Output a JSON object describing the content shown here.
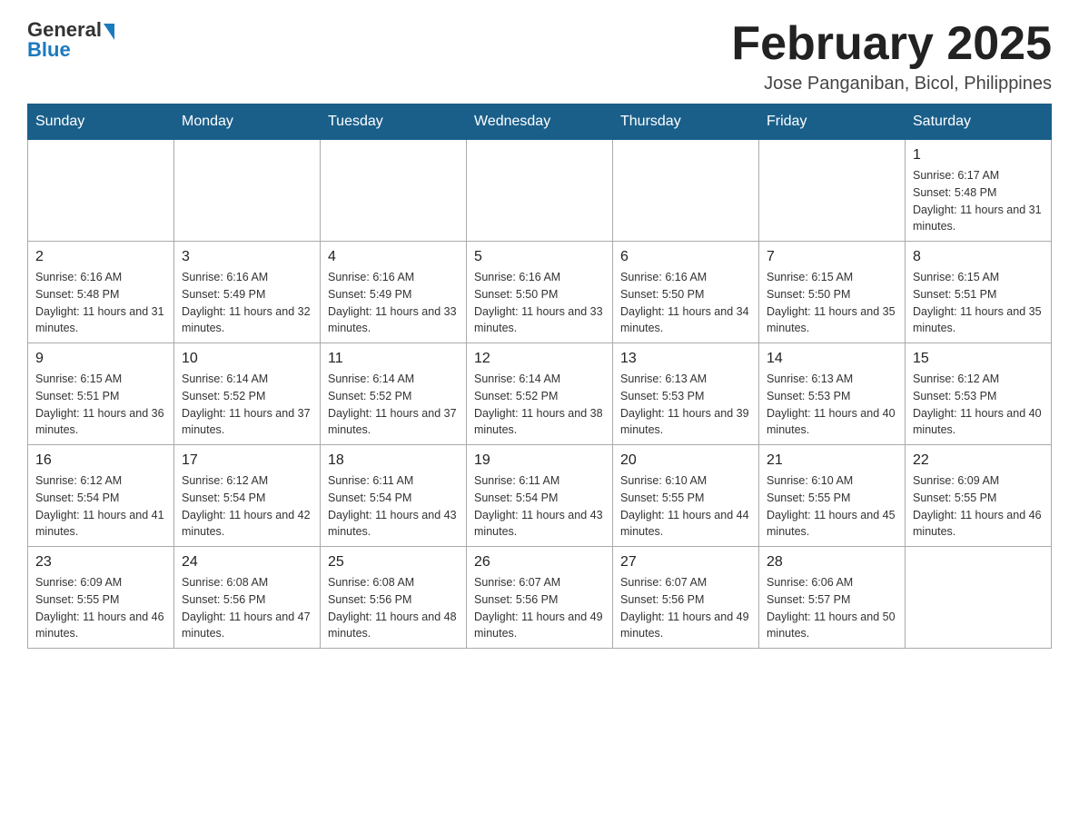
{
  "logo": {
    "general": "General",
    "blue": "Blue"
  },
  "title": "February 2025",
  "location": "Jose Panganiban, Bicol, Philippines",
  "days_of_week": [
    "Sunday",
    "Monday",
    "Tuesday",
    "Wednesday",
    "Thursday",
    "Friday",
    "Saturday"
  ],
  "weeks": [
    [
      {
        "day": "",
        "info": ""
      },
      {
        "day": "",
        "info": ""
      },
      {
        "day": "",
        "info": ""
      },
      {
        "day": "",
        "info": ""
      },
      {
        "day": "",
        "info": ""
      },
      {
        "day": "",
        "info": ""
      },
      {
        "day": "1",
        "info": "Sunrise: 6:17 AM\nSunset: 5:48 PM\nDaylight: 11 hours and 31 minutes."
      }
    ],
    [
      {
        "day": "2",
        "info": "Sunrise: 6:16 AM\nSunset: 5:48 PM\nDaylight: 11 hours and 31 minutes."
      },
      {
        "day": "3",
        "info": "Sunrise: 6:16 AM\nSunset: 5:49 PM\nDaylight: 11 hours and 32 minutes."
      },
      {
        "day": "4",
        "info": "Sunrise: 6:16 AM\nSunset: 5:49 PM\nDaylight: 11 hours and 33 minutes."
      },
      {
        "day": "5",
        "info": "Sunrise: 6:16 AM\nSunset: 5:50 PM\nDaylight: 11 hours and 33 minutes."
      },
      {
        "day": "6",
        "info": "Sunrise: 6:16 AM\nSunset: 5:50 PM\nDaylight: 11 hours and 34 minutes."
      },
      {
        "day": "7",
        "info": "Sunrise: 6:15 AM\nSunset: 5:50 PM\nDaylight: 11 hours and 35 minutes."
      },
      {
        "day": "8",
        "info": "Sunrise: 6:15 AM\nSunset: 5:51 PM\nDaylight: 11 hours and 35 minutes."
      }
    ],
    [
      {
        "day": "9",
        "info": "Sunrise: 6:15 AM\nSunset: 5:51 PM\nDaylight: 11 hours and 36 minutes."
      },
      {
        "day": "10",
        "info": "Sunrise: 6:14 AM\nSunset: 5:52 PM\nDaylight: 11 hours and 37 minutes."
      },
      {
        "day": "11",
        "info": "Sunrise: 6:14 AM\nSunset: 5:52 PM\nDaylight: 11 hours and 37 minutes."
      },
      {
        "day": "12",
        "info": "Sunrise: 6:14 AM\nSunset: 5:52 PM\nDaylight: 11 hours and 38 minutes."
      },
      {
        "day": "13",
        "info": "Sunrise: 6:13 AM\nSunset: 5:53 PM\nDaylight: 11 hours and 39 minutes."
      },
      {
        "day": "14",
        "info": "Sunrise: 6:13 AM\nSunset: 5:53 PM\nDaylight: 11 hours and 40 minutes."
      },
      {
        "day": "15",
        "info": "Sunrise: 6:12 AM\nSunset: 5:53 PM\nDaylight: 11 hours and 40 minutes."
      }
    ],
    [
      {
        "day": "16",
        "info": "Sunrise: 6:12 AM\nSunset: 5:54 PM\nDaylight: 11 hours and 41 minutes."
      },
      {
        "day": "17",
        "info": "Sunrise: 6:12 AM\nSunset: 5:54 PM\nDaylight: 11 hours and 42 minutes."
      },
      {
        "day": "18",
        "info": "Sunrise: 6:11 AM\nSunset: 5:54 PM\nDaylight: 11 hours and 43 minutes."
      },
      {
        "day": "19",
        "info": "Sunrise: 6:11 AM\nSunset: 5:54 PM\nDaylight: 11 hours and 43 minutes."
      },
      {
        "day": "20",
        "info": "Sunrise: 6:10 AM\nSunset: 5:55 PM\nDaylight: 11 hours and 44 minutes."
      },
      {
        "day": "21",
        "info": "Sunrise: 6:10 AM\nSunset: 5:55 PM\nDaylight: 11 hours and 45 minutes."
      },
      {
        "day": "22",
        "info": "Sunrise: 6:09 AM\nSunset: 5:55 PM\nDaylight: 11 hours and 46 minutes."
      }
    ],
    [
      {
        "day": "23",
        "info": "Sunrise: 6:09 AM\nSunset: 5:55 PM\nDaylight: 11 hours and 46 minutes."
      },
      {
        "day": "24",
        "info": "Sunrise: 6:08 AM\nSunset: 5:56 PM\nDaylight: 11 hours and 47 minutes."
      },
      {
        "day": "25",
        "info": "Sunrise: 6:08 AM\nSunset: 5:56 PM\nDaylight: 11 hours and 48 minutes."
      },
      {
        "day": "26",
        "info": "Sunrise: 6:07 AM\nSunset: 5:56 PM\nDaylight: 11 hours and 49 minutes."
      },
      {
        "day": "27",
        "info": "Sunrise: 6:07 AM\nSunset: 5:56 PM\nDaylight: 11 hours and 49 minutes."
      },
      {
        "day": "28",
        "info": "Sunrise: 6:06 AM\nSunset: 5:57 PM\nDaylight: 11 hours and 50 minutes."
      },
      {
        "day": "",
        "info": ""
      }
    ]
  ]
}
